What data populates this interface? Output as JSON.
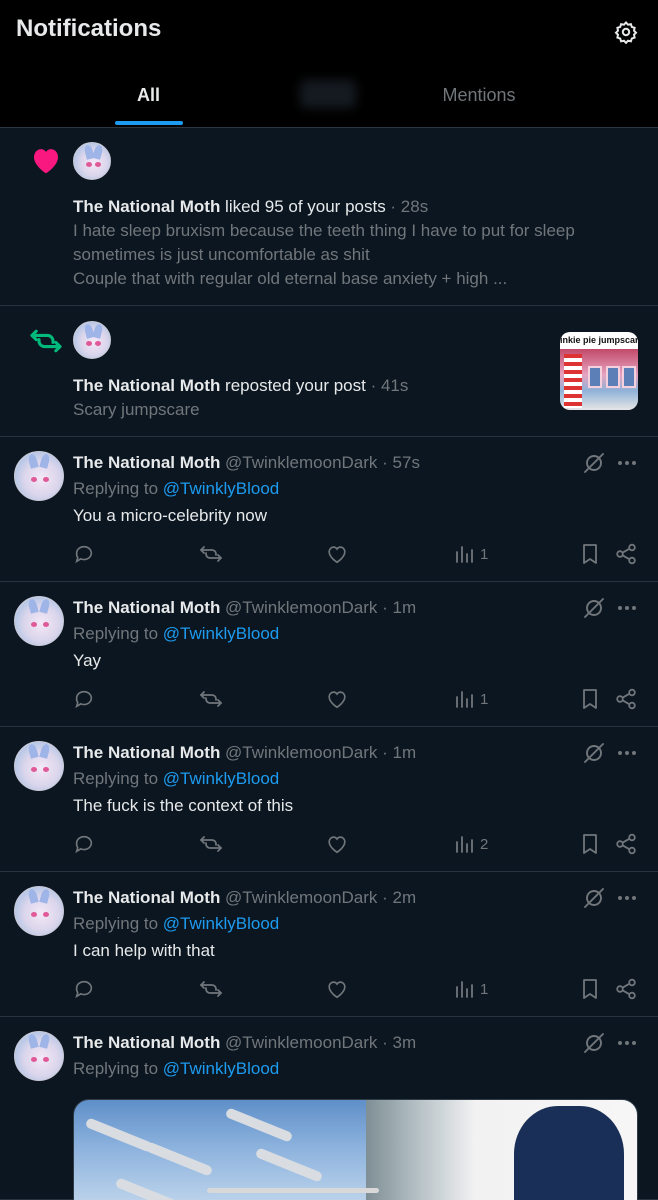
{
  "header": {
    "title": "Notifications",
    "settings_icon": "gear-icon"
  },
  "tabs": [
    {
      "label": "All",
      "active": true
    },
    {
      "label": "",
      "active": false,
      "note_obscured": true
    },
    {
      "label": "Mentions",
      "active": false
    }
  ],
  "colors": {
    "accent": "#1d9bf0",
    "like": "#f91880",
    "repost": "#00ba7c",
    "background": "#0b1620",
    "muted": "#71767b"
  },
  "notifications": [
    {
      "type": "like",
      "icon": "heart-icon",
      "user": "The National Moth",
      "action": " liked 95 of your posts",
      "time": " · 28s",
      "text_lines": [
        "I hate sleep bruxism because the teeth thing I have to put for sleep",
        "sometimes is just uncomfortable as shit",
        "Couple that with regular old eternal base anxiety + high ..."
      ]
    },
    {
      "type": "repost",
      "icon": "repost-icon",
      "user": "The National Moth",
      "action": " reposted your post",
      "time": " · 41s",
      "text": "Scary jumpscare",
      "thumbnail_text": "inkie pie jumpscare"
    }
  ],
  "replies": [
    {
      "name": "The National Moth",
      "handle": " @TwinklemoonDark",
      "time": " · 57s",
      "replying_label": "Replying to ",
      "replying_to": "@TwinklyBlood",
      "text": "You a micro-celebrity now",
      "views": "1"
    },
    {
      "name": "The National Moth",
      "handle": " @TwinklemoonDark",
      "time": " · 1m",
      "replying_label": "Replying to ",
      "replying_to": "@TwinklyBlood",
      "text": "Yay",
      "views": "1"
    },
    {
      "name": "The National Moth",
      "handle": " @TwinklemoonDark",
      "time": " · 1m",
      "replying_label": "Replying to ",
      "replying_to": "@TwinklyBlood",
      "text": "The fuck is the context of this",
      "views": "2"
    },
    {
      "name": "The National Moth",
      "handle": " @TwinklemoonDark",
      "time": " · 2m",
      "replying_label": "Replying to ",
      "replying_to": "@TwinklyBlood",
      "text": "I can help with that",
      "views": "1"
    },
    {
      "name": "The National Moth",
      "handle": " @TwinklemoonDark",
      "time": " · 3m",
      "replying_label": "Replying to ",
      "replying_to": "@TwinklyBlood",
      "text": "",
      "views": ""
    }
  ]
}
